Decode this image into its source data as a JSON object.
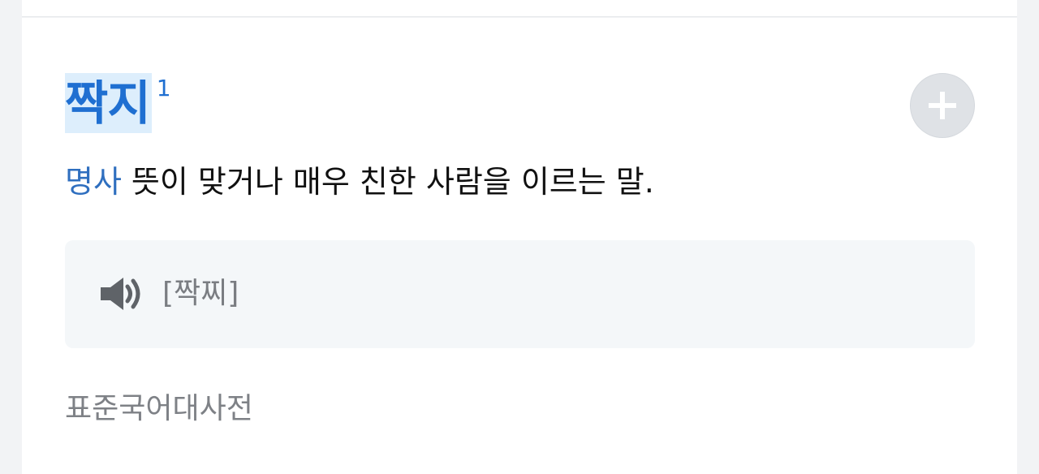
{
  "entry": {
    "headword": "짝지",
    "superscript": "1",
    "part_of_speech": "명사",
    "definition": "뜻이 맞거나 매우 친한 사람을 이르는 말.",
    "pronunciation": "[짝찌]",
    "source": "표준국어대사전"
  },
  "icons": {
    "add": "plus-circle-icon",
    "audio": "speaker-icon"
  },
  "colors": {
    "headword": "#1f6fd1",
    "headword_highlight": "#ddeefc",
    "part_of_speech": "#2f6fbf",
    "pron_box_bg": "#f4f7f9",
    "muted_text": "#7e8186"
  }
}
